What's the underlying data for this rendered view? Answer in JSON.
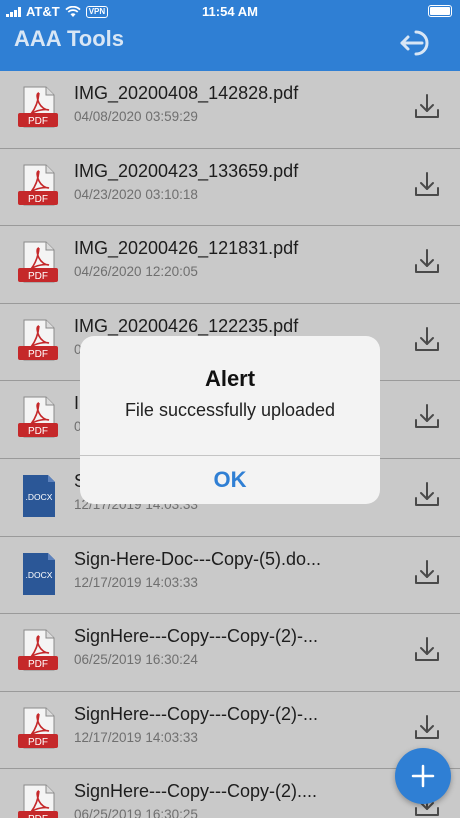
{
  "status_bar": {
    "carrier": "AT&T",
    "vpn": "VPN",
    "time": "11:54 AM"
  },
  "app_bar": {
    "title": "AAA Tools"
  },
  "files": [
    {
      "icon": "pdf",
      "name": "IMG_20200408_142828.pdf",
      "date": "04/08/2020 03:59:29"
    },
    {
      "icon": "pdf",
      "name": "IMG_20200423_133659.pdf",
      "date": "04/23/2020 03:10:18"
    },
    {
      "icon": "pdf",
      "name": "IMG_20200426_121831.pdf",
      "date": "04/26/2020 12:20:05"
    },
    {
      "icon": "pdf",
      "name": "IMG_20200426_122235.pdf",
      "date": "0"
    },
    {
      "icon": "pdf",
      "name": "I",
      "date": "0"
    },
    {
      "icon": "docx",
      "name": "S",
      "date": "12/17/2019 14:03:33"
    },
    {
      "icon": "docx",
      "name": "Sign-Here-Doc---Copy-(5).do...",
      "date": "12/17/2019 14:03:33"
    },
    {
      "icon": "pdf",
      "name": "SignHere---Copy---Copy-(2)-...",
      "date": "06/25/2019 16:30:24"
    },
    {
      "icon": "pdf",
      "name": "SignHere---Copy---Copy-(2)-...",
      "date": "12/17/2019 14:03:33"
    },
    {
      "icon": "pdf",
      "name": "SignHere---Copy---Copy-(2)....",
      "date": "06/25/2019 16:30:25"
    }
  ],
  "icon_labels": {
    "pdf": "PDF",
    "docx": ".DOCX"
  },
  "alert": {
    "title": "Alert",
    "message": "File successfully uploaded",
    "ok_label": "OK"
  },
  "colors": {
    "accent": "#2f7fd4",
    "pdf_red": "#c5282a",
    "docx_blue": "#2b5797"
  },
  "icons": [
    "logout-icon",
    "download-icon",
    "pdf-file-icon",
    "docx-file-icon",
    "add-icon"
  ]
}
